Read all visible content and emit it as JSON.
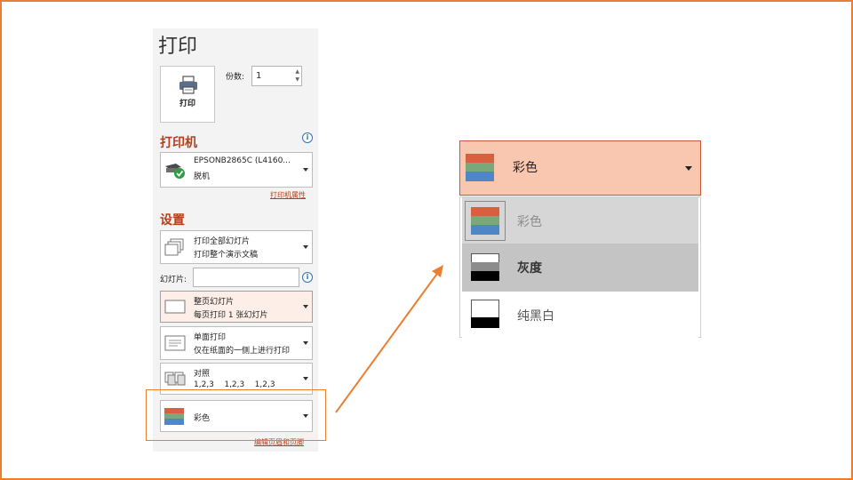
{
  "panel": {
    "title": "打印",
    "print_button_label": "打印",
    "copies_label": "份数:",
    "copies_value": "1",
    "printer_section": "打印机",
    "printer": {
      "name": "EPSONB2865C (L4160...",
      "status": "脱机"
    },
    "printer_properties_link": "打印机属性",
    "settings_section": "设置",
    "print_range": {
      "line1": "打印全部幻灯片",
      "line2": "打印整个演示文稿"
    },
    "slides_label": "幻灯片:",
    "slides_value": "",
    "layout": {
      "line1": "整页幻灯片",
      "line2": "每页打印 1 张幻灯片"
    },
    "sides": {
      "line1": "单面打印",
      "line2": "仅在纸面的一侧上进行打印"
    },
    "collation": {
      "line1": "对照",
      "line2": "1,2,3    1,2,3    1,2,3"
    },
    "color": {
      "label": "彩色"
    },
    "edit_header_footer_link": "编辑页眉和页脚"
  },
  "zoom": {
    "selected_label": "彩色",
    "options": [
      {
        "label": "彩色",
        "state": "checked"
      },
      {
        "label": "灰度",
        "state": "hover"
      },
      {
        "label": "纯黑白",
        "state": "normal"
      }
    ]
  },
  "colors": {
    "accent": "#ed7d31",
    "section_title": "#b63e1c",
    "color_icon": [
      "#d8603f",
      "#7aa878",
      "#4f86c6"
    ],
    "grayscale_icon": [
      "#ffffff",
      "#8c8c8c",
      "#000000"
    ],
    "bw_icon": [
      "#ffffff",
      "#ffffff",
      "#000000"
    ]
  },
  "icons": [
    "printer-icon",
    "info-icon",
    "printer-status-icon",
    "slides-icon",
    "page-icon",
    "duplex-icon",
    "collate-icon",
    "color-icon",
    "dropdown-arrow-icon",
    "spin-up-icon",
    "spin-down-icon",
    "grayscale-icon",
    "black-white-icon",
    "pointer-arrow"
  ]
}
